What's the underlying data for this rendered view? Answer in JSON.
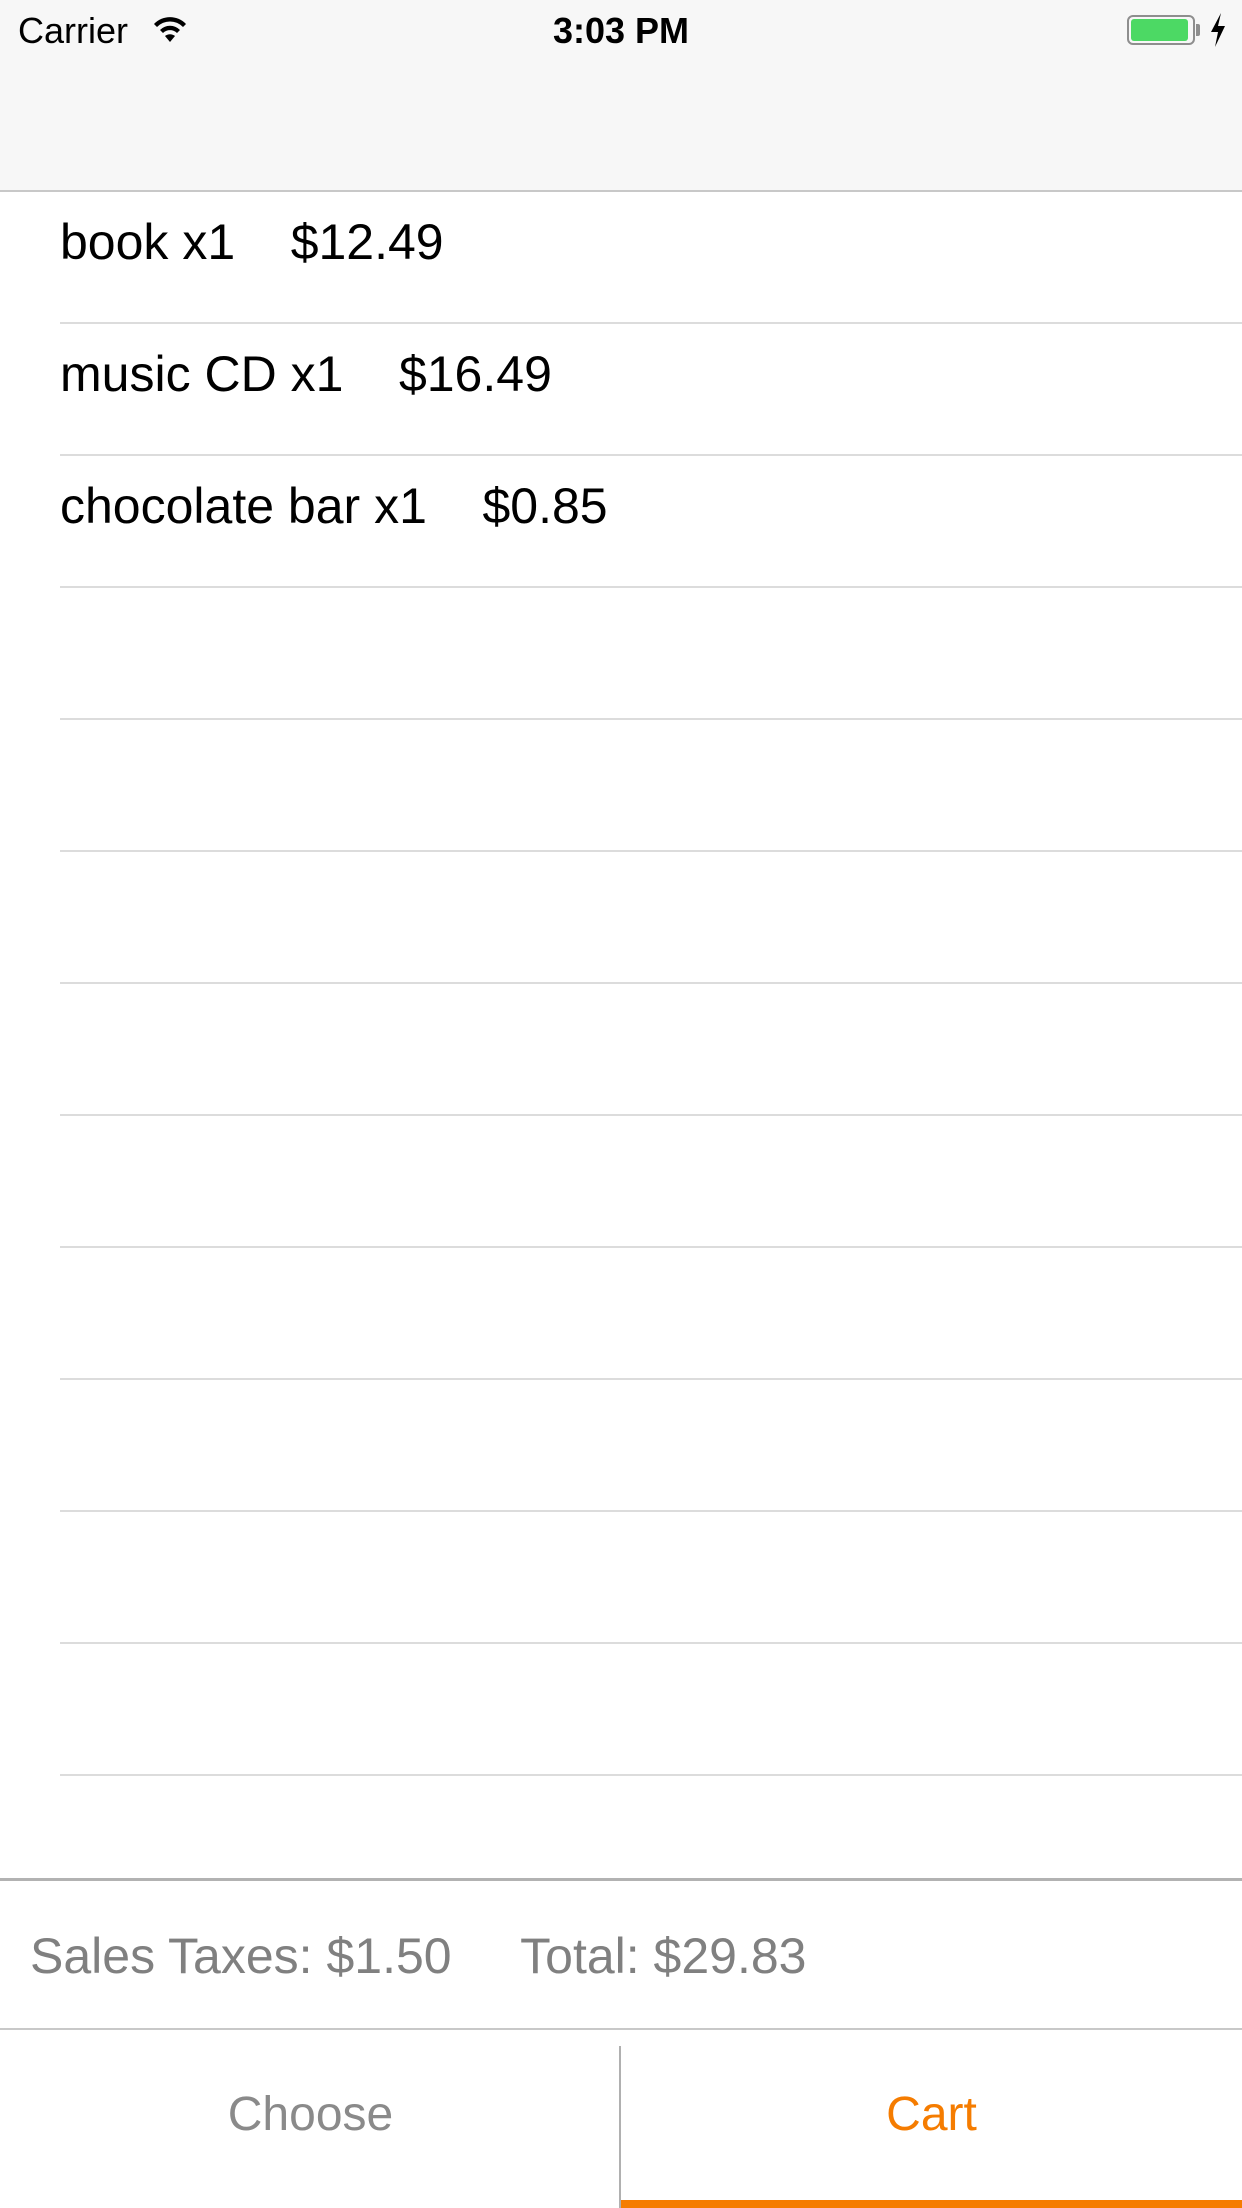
{
  "status_bar": {
    "carrier": "Carrier",
    "time": "3:03 PM",
    "battery_level_fraction": 0.95,
    "battery_color": "#4cd964",
    "icons": [
      "wifi-icon",
      "battery-icon",
      "charging-bolt-icon"
    ]
  },
  "cart": {
    "items": [
      {
        "label": "book x1    $12.49"
      },
      {
        "label": "music CD x1    $16.49"
      },
      {
        "label": "chocolate bar x1    $0.85"
      },
      {
        "label": ""
      },
      {
        "label": ""
      },
      {
        "label": ""
      },
      {
        "label": ""
      },
      {
        "label": ""
      },
      {
        "label": ""
      },
      {
        "label": ""
      },
      {
        "label": ""
      },
      {
        "label": ""
      }
    ]
  },
  "summary": {
    "text": "Sales Taxes: $1.50     Total: $29.83"
  },
  "tabs": {
    "choose": "Choose",
    "cart": "Cart",
    "active": "cart",
    "accent_color": "#f57c00",
    "inactive_color": "#8a8a8a"
  }
}
